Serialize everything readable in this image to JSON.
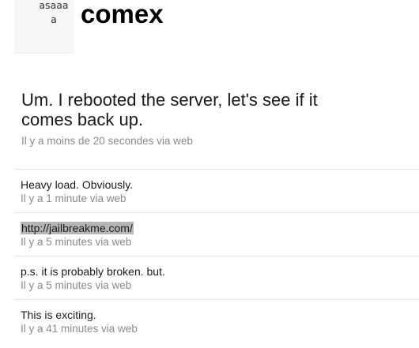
{
  "profile": {
    "avatar_text": "asaaa\na",
    "username": "comex"
  },
  "latest_status": {
    "text": "Um. I rebooted the server, let's see if it comes back up.",
    "meta": "Il y a moins de 20 secondes via web"
  },
  "timeline": [
    {
      "text": "Heavy load. Obviously.",
      "meta": "Il y a 1 minute via web"
    },
    {
      "text": "http://jailbreakme.com/",
      "meta": "Il y a 5 minutes via web"
    },
    {
      "text": "p.s. it is probably broken. but.",
      "meta": "Il y a 5 minutes via web"
    },
    {
      "text": "This is exciting.",
      "meta": "Il y a 41 minutes via web"
    }
  ],
  "colors": {
    "meta_text": "#8a8a8a",
    "link_highlight": "#b6b6b6",
    "divider": "#e6e6e6"
  }
}
